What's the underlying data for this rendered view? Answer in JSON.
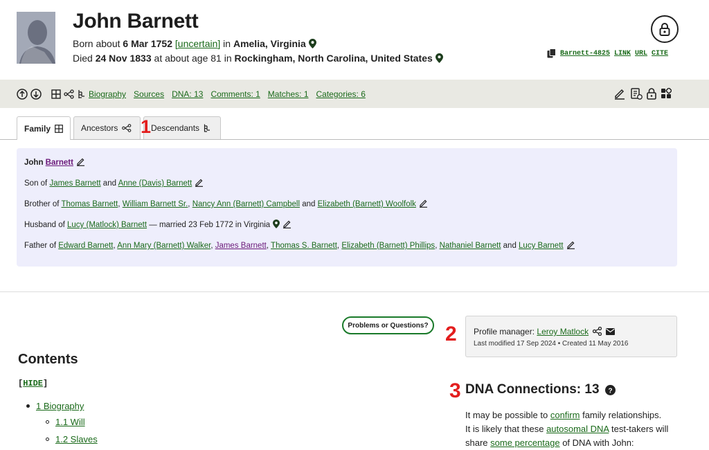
{
  "person": {
    "name": "John Barnett",
    "born_prefix": "Born about ",
    "born_date": "6 Mar 1752",
    "born_uncertain": "[uncertain]",
    "born_in": " in ",
    "born_place": "Amelia, Virginia",
    "died_prefix": "Died ",
    "died_date": "24 Nov 1833",
    "died_age": " at about age 81 in ",
    "died_place": "Rockingham, North Carolina, United States"
  },
  "id_links": {
    "id": "Barnett-4825",
    "link": "LINK",
    "url": "URL",
    "cite": "CITE"
  },
  "toolbar": {
    "links": [
      "Biography",
      "Sources",
      "DNA: 13",
      "Comments: 1",
      "Matches: 1",
      "Categories: 6"
    ]
  },
  "tabs": [
    "Family",
    "Ancestors",
    "Descendants"
  ],
  "annotations": {
    "one": "1",
    "two": "2",
    "three": "3"
  },
  "family": {
    "self_first": "John ",
    "self_last": "Barnett",
    "son_of": "Son of ",
    "father": "James Barnett",
    "and": " and ",
    "mother": "Anne (Davis) Barnett",
    "brother_of": "Brother of ",
    "siblings": [
      "Thomas Barnett",
      "William Barnett Sr.",
      "Nancy Ann (Barnett) Campbell",
      "Elizabeth (Barnett) Woolfolk"
    ],
    "husband_of": "Husband of ",
    "spouse": "Lucy (Matlock) Barnett",
    "married": " — married 23 Feb 1772 in Virginia",
    "father_of": "Father of ",
    "children": [
      "Edward Barnett",
      "Ann Mary (Barnett) Walker",
      "James Barnett",
      "Thomas S. Barnett",
      "Elizabeth (Barnett) Phillips",
      "Nathaniel Barnett",
      "Lucy Barnett"
    ]
  },
  "problems_button": "Problems or Questions?",
  "manager": {
    "label": "Profile manager: ",
    "name": "Leroy Matlock",
    "modified": "Last modified 17 Sep 2024 • Created 11 May 2016"
  },
  "contents": {
    "heading": "Contents",
    "hide": "HIDE",
    "items": [
      "1 Biography",
      "1.1 Will",
      "1.2 Slaves"
    ]
  },
  "dna": {
    "heading": "DNA Connections: 13",
    "line1_a": "It may be possible to ",
    "line1_link": "confirm",
    "line1_b": " family relationships.",
    "line2_a": "It is likely that these ",
    "line2_link": "autosomal DNA",
    "line2_b": " test-takers will",
    "line3_a": "share ",
    "line3_link": "some percentage",
    "line3_b": " of DNA with John:"
  },
  "colors": {
    "link_green": "#1a6a1a",
    "purple_link": "#6b1a7a",
    "toolbar_bg": "#e9e9e3",
    "family_bg": "#eeeefc",
    "annotation_red": "#e31e1e"
  }
}
